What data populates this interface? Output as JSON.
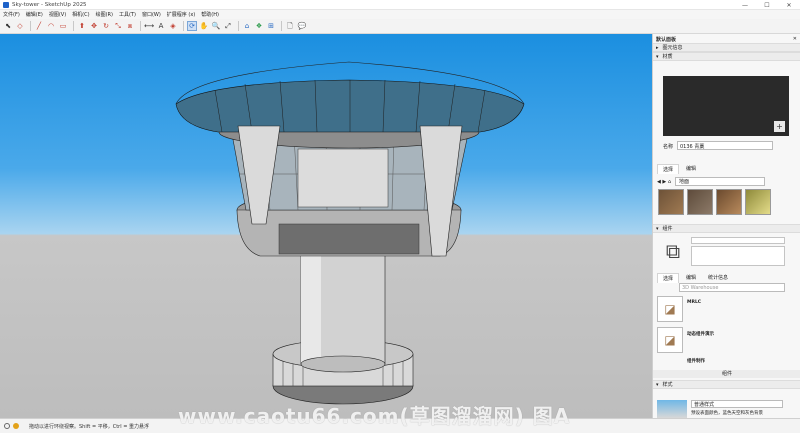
{
  "window": {
    "title": "Sky-tower - SketchUp 2025",
    "minimize": "—",
    "maximize": "☐",
    "close": "✕"
  },
  "menu": [
    "文件(F)",
    "编辑(E)",
    "视图(V)",
    "相机(C)",
    "绘图(R)",
    "工具(T)",
    "窗口(W)",
    "扩展程序 (x)",
    "帮助(H)"
  ],
  "toolbar": {
    "icons": [
      "select-icon",
      "eraser-icon",
      "line-icon",
      "arc-icon",
      "rectangle-icon",
      "push-pull-icon",
      "move-icon",
      "rotate-icon",
      "scale-icon",
      "offset-icon",
      "tape-measure-icon",
      "text-icon",
      "paint-icon",
      "orbit-icon",
      "pan-icon",
      "zoom-icon",
      "zoom-extents-icon",
      "warehouse-icon",
      "extension-icon",
      "layout-icon",
      "new-file-icon",
      "comment-icon"
    ],
    "glyphs": [
      "⬉",
      "◇",
      "╱",
      "◠",
      "▭",
      "⬆",
      "✥",
      "↻",
      "⤡",
      "⧈",
      "⟷",
      "A",
      "◈",
      "⟳",
      "✋",
      "🔍",
      "⤢",
      "⌂",
      "❖",
      "⊞",
      "🗋",
      "💬"
    ]
  },
  "tray": {
    "title": "默认面板",
    "close": "✕",
    "sections": {
      "entity_info": "图元信息",
      "materials": "材质",
      "components": "组件",
      "styles": "样式"
    },
    "material": {
      "name_label": "名称",
      "name_value": "0136 青藁",
      "tabs": [
        "选择",
        "编辑"
      ],
      "collection": "地面"
    },
    "components": {
      "tabs": [
        "选择",
        "编辑",
        "统计信息"
      ],
      "search_placeholder": "3D Warehouse",
      "items": [
        "MRLC",
        "动态组件演示",
        "组件制作"
      ],
      "footer": "组件"
    },
    "styles": {
      "name": "普通样式",
      "description": "预设表面颜色，蓝色天空和灰色背景"
    }
  },
  "status": {
    "hint": "拖动以进行环绕视察。Shift = 平移，Ctrl = 重力悬浮"
  },
  "watermark": "www.caotu66.com(草图溜溜网) 图A"
}
